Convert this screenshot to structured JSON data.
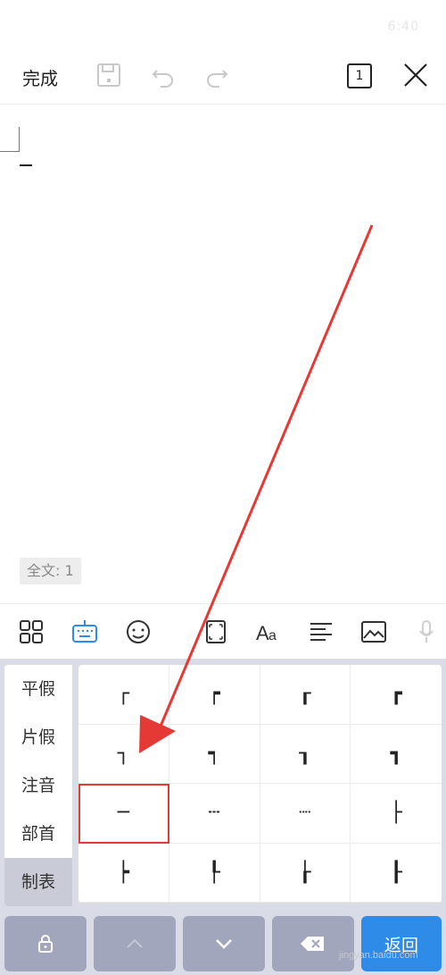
{
  "status_bar": {
    "time": "6:40",
    "left_text": "..."
  },
  "toolbar": {
    "done_label": "完成",
    "page_indicator": "1"
  },
  "editor": {
    "word_count": "全文: 1"
  },
  "keyboard": {
    "categories": [
      {
        "label": "平假"
      },
      {
        "label": "片假"
      },
      {
        "label": "注音"
      },
      {
        "label": "部首"
      },
      {
        "label": "制表"
      }
    ],
    "active_category": "制表",
    "symbols": [
      "┌",
      "┍",
      "┎",
      "┏",
      "┐",
      "┑",
      "┒",
      "┓",
      "─",
      "┄",
      "┈",
      "├",
      "┝",
      "┞",
      "┟",
      "┠"
    ],
    "highlighted_symbol": "─",
    "return_label": "返回"
  },
  "colors": {
    "accent": "#2f8be8",
    "highlight": "#e53935",
    "arrow": "#e53935"
  },
  "watermark": "jingyan.baidu.com"
}
